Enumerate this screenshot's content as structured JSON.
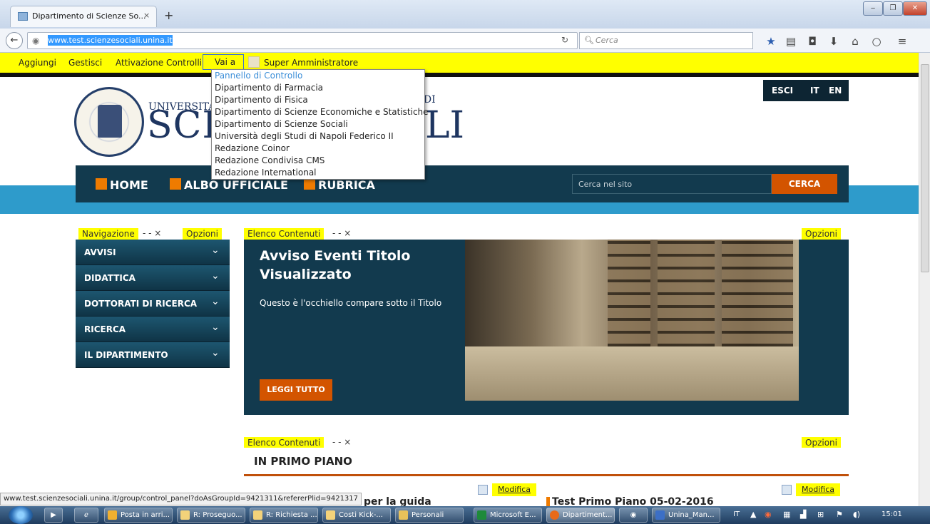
{
  "browser": {
    "tab_title": "Dipartimento di Scienze So...",
    "tab_close": "×",
    "new_tab": "+",
    "url": "www.test.scienzesociali.unina.it",
    "search_placeholder": "Cerca",
    "window_buttons": [
      "‒",
      "❐",
      "✕"
    ]
  },
  "dockbar": {
    "items": [
      "Aggiungi",
      "Gestisci",
      "Attivazione Controlli"
    ],
    "go_to": "Vai a",
    "user": "Super Amministratore"
  },
  "goto_menu": {
    "items": [
      "Pannello di Controllo",
      "Dipartimento di Farmacia",
      "Dipartimento di Fisica",
      "Dipartimento di Scienze Economiche e Statistiche",
      "Dipartimento di Scienze Sociali",
      "Università degli Studi di Napoli Federico II",
      "Redazione Coinor",
      "Redazione Condivisa CMS",
      "Redazione International"
    ]
  },
  "header": {
    "uni_prefix": "UNIVERSITÀ DE",
    "uni_suffix": "O DI",
    "big_left": "SCIE",
    "big_right": "LI",
    "lang_buttons": [
      "ESCI",
      "IT",
      "EN"
    ]
  },
  "main_menu": {
    "items": [
      "HOME",
      "ALBO UFFICIALE",
      "RUBRICA"
    ],
    "search_placeholder": "Cerca nel sito",
    "search_button": "CERCA"
  },
  "portlets": {
    "nav_label": "Navigazione",
    "controls": "- - ×",
    "options": "Opzioni",
    "content_label": "Elenco Contenuti"
  },
  "navigation": {
    "items": [
      "AVVISI",
      "DIDATTICA",
      "DOTTORATI DI RICERCA",
      "RICERCA",
      "IL DIPARTIMENTO"
    ],
    "chevron": "⌄"
  },
  "hero": {
    "title": "Avviso Eventi Titolo Visualizzato",
    "subtitle": "Questo è l'occhiello compare sotto il Titolo",
    "button": "LEGGI TUTTO"
  },
  "primo_piano": {
    "title": "IN PRIMO PIANO",
    "edit_label": "Modifica",
    "left_title": "per la guida",
    "right_title": "Test Primo Piano 05-02-2016"
  },
  "status_url": "www.test.scienzesociali.unina.it/group/control_panel?doAsGroupId=9421311&refererPlid=9421317",
  "taskbar": {
    "items": [
      {
        "label": "Posta in arri...",
        "color": "#f0b030"
      },
      {
        "label": "R: Proseguo...",
        "color": "#f3d27a"
      },
      {
        "label": "R: Richiesta ...",
        "color": "#f3d27a"
      },
      {
        "label": "Costi Kick-...",
        "color": "#f3d27a"
      },
      {
        "label": "Personali",
        "color": "#e8c25a"
      },
      {
        "label": "Microsoft E...",
        "color": "#1e8a3a"
      },
      {
        "label": "Dipartiment...",
        "color": "#e86a1a"
      },
      {
        "label": "Unina_Man...",
        "color": "#3c6fc6"
      }
    ],
    "lang": "IT",
    "time": "15:01"
  },
  "colors": {
    "dockbar": "#ffff00",
    "navy": "#123a4e",
    "orange": "#d35400",
    "accent_square": "#ef7b00"
  }
}
